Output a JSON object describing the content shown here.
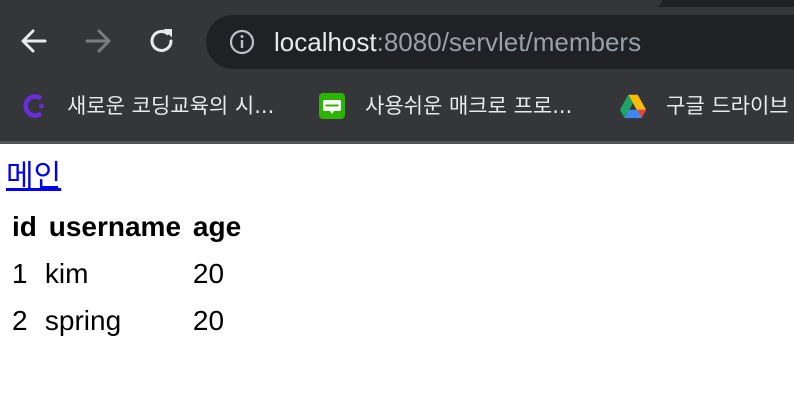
{
  "browser": {
    "omnibox": {
      "host": "localhost",
      "rest": ":8080/servlet/members"
    },
    "bookmarks": [
      {
        "label": "새로운 코딩교육의 시...",
        "icon": "codeit-icon"
      },
      {
        "label": "사용쉬운 매크로 프로...",
        "icon": "blog-icon"
      },
      {
        "label": "구글 드라이브",
        "icon": "google-drive-icon"
      }
    ],
    "colors": {
      "toolbar": "#35363a",
      "omnibox": "#202124",
      "link": "#0000ee"
    }
  },
  "page": {
    "main_link": "메인",
    "table": {
      "headers": [
        "id",
        "username",
        "age"
      ],
      "rows": [
        [
          "1",
          "kim",
          "20"
        ],
        [
          "2",
          "spring",
          "20"
        ]
      ]
    }
  }
}
